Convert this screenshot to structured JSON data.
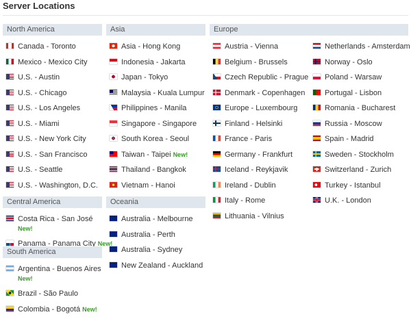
{
  "page": {
    "title": "Server Locations"
  },
  "new_label": "New!",
  "regions": {
    "north_america": {
      "label": "North America",
      "items": [
        {
          "name": "Canada - Toronto",
          "flag": "ca"
        },
        {
          "name": "Mexico - Mexico City",
          "flag": "mx"
        },
        {
          "name": "U.S. - Austin",
          "flag": "us"
        },
        {
          "name": "U.S. - Chicago",
          "flag": "us"
        },
        {
          "name": "U.S. - Los Angeles",
          "flag": "us"
        },
        {
          "name": "U.S. - Miami",
          "flag": "us"
        },
        {
          "name": "U.S. - New York City",
          "flag": "us"
        },
        {
          "name": "U.S. - San Francisco",
          "flag": "us"
        },
        {
          "name": "U.S. - Seattle",
          "flag": "us"
        },
        {
          "name": "U.S. - Washington, D.C.",
          "flag": "us"
        }
      ]
    },
    "central_america": {
      "label": "Central America",
      "items": [
        {
          "name": "Costa Rica - San José",
          "flag": "cr",
          "new": true
        },
        {
          "name": "Panama - Panama City",
          "flag": "pa",
          "new": true
        }
      ]
    },
    "south_america": {
      "label": "South America",
      "items": [
        {
          "name": "Argentina - Buenos Aires",
          "flag": "ar",
          "new": true
        },
        {
          "name": "Brazil - São Paulo",
          "flag": "br"
        },
        {
          "name": "Colombia - Bogotá",
          "flag": "co",
          "new": true
        }
      ]
    },
    "asia": {
      "label": "Asia",
      "items": [
        {
          "name": "Asia - Hong Kong",
          "flag": "hk"
        },
        {
          "name": "Indonesia - Jakarta",
          "flag": "id"
        },
        {
          "name": "Japan - Tokyo",
          "flag": "jp"
        },
        {
          "name": "Malaysia - Kuala Lumpur",
          "flag": "my"
        },
        {
          "name": "Philippines - Manila",
          "flag": "ph"
        },
        {
          "name": "Singapore - Singapore",
          "flag": "sg"
        },
        {
          "name": "South Korea - Seoul",
          "flag": "kr"
        },
        {
          "name": "Taiwan - Taipei",
          "flag": "tw",
          "new": true
        },
        {
          "name": "Thailand - Bangkok",
          "flag": "th"
        },
        {
          "name": "Vietnam - Hanoi",
          "flag": "vn"
        }
      ]
    },
    "oceania": {
      "label": "Oceania",
      "items": [
        {
          "name": "Australia - Melbourne",
          "flag": "au"
        },
        {
          "name": "Australia - Perth",
          "flag": "au"
        },
        {
          "name": "Australia - Sydney",
          "flag": "au"
        },
        {
          "name": "New Zealand - Auckland",
          "flag": "nz"
        }
      ]
    },
    "europe": {
      "label": "Europe",
      "col1": [
        {
          "name": "Austria - Vienna",
          "flag": "at"
        },
        {
          "name": "Belgium - Brussels",
          "flag": "be"
        },
        {
          "name": "Czech Republic - Prague",
          "flag": "cz"
        },
        {
          "name": "Denmark - Copenhagen",
          "flag": "dk"
        },
        {
          "name": "Europe - Luxembourg",
          "flag": "eu"
        },
        {
          "name": "Finland - Helsinki",
          "flag": "fi"
        },
        {
          "name": "France - Paris",
          "flag": "fr"
        },
        {
          "name": "Germany - Frankfurt",
          "flag": "de"
        },
        {
          "name": "Iceland - Reykjavik",
          "flag": "is"
        },
        {
          "name": "Ireland - Dublin",
          "flag": "ie"
        },
        {
          "name": "Italy - Rome",
          "flag": "it"
        },
        {
          "name": "Lithuania - Vilnius",
          "flag": "lt"
        }
      ],
      "col2": [
        {
          "name": "Netherlands - Amsterdam",
          "flag": "nl"
        },
        {
          "name": "Norway - Oslo",
          "flag": "no"
        },
        {
          "name": "Poland - Warsaw",
          "flag": "pl"
        },
        {
          "name": "Portugal - Lisbon",
          "flag": "pt"
        },
        {
          "name": "Romania - Bucharest",
          "flag": "ro"
        },
        {
          "name": "Russia - Moscow",
          "flag": "ru"
        },
        {
          "name": "Spain - Madrid",
          "flag": "es"
        },
        {
          "name": "Sweden - Stockholm",
          "flag": "se"
        },
        {
          "name": "Switzerland - Zurich",
          "flag": "ch"
        },
        {
          "name": "Turkey - Istanbul",
          "flag": "tr"
        },
        {
          "name": "U.K. - London",
          "flag": "gb"
        }
      ]
    }
  }
}
